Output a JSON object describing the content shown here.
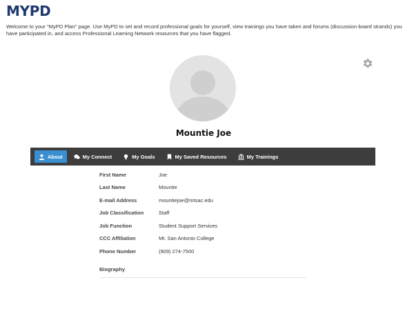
{
  "header": {
    "title": "MYPD",
    "intro": "Welcome to your \"MyPD Plan\" page. Use MyPD to set and record professional goals for yourself, view trainings you have taken and forums (discussion-board strands) you have participated in, and access Professional Learning Network resources that you have flagged."
  },
  "profile": {
    "name": "Mountie Joe",
    "settings_icon": "gear-icon",
    "avatar_icon": "user-silhouette-icon"
  },
  "tabs": [
    {
      "label": "About",
      "icon": "user-icon",
      "active": true
    },
    {
      "label": "My Connect",
      "icon": "chat-bubbles-icon",
      "active": false
    },
    {
      "label": "My Goals",
      "icon": "lightbulb-icon",
      "active": false
    },
    {
      "label": "My Saved Resources",
      "icon": "bookmark-icon",
      "active": false
    },
    {
      "label": "My Trainings",
      "icon": "institution-icon",
      "active": false
    }
  ],
  "fields": [
    {
      "label": "First Name",
      "value": "Joe"
    },
    {
      "label": "Last Name",
      "value": "Mountie"
    },
    {
      "label": "E-mail Address",
      "value": "mountiejoe@mtsac.edu"
    },
    {
      "label": "Job Classification",
      "value": "Staff"
    },
    {
      "label": "Job Function",
      "value": "Student Support Services"
    },
    {
      "label": "CCC Affiliation",
      "value": "Mt. San Antonio College"
    },
    {
      "label": "Phone Number",
      "value": "(909) 274-7500"
    }
  ],
  "biography": {
    "label": "Biography",
    "value": ""
  },
  "colors": {
    "title": "#1f3a6e",
    "tabbar": "#3d3d3d",
    "active_tab": "#3a8fd0"
  }
}
